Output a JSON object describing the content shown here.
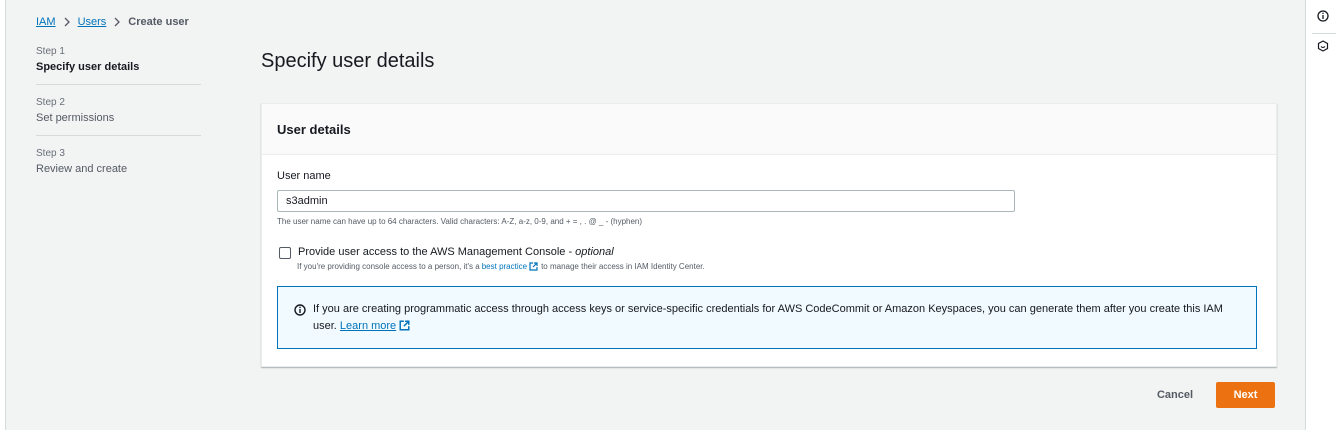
{
  "breadcrumb": {
    "items": [
      {
        "label": "IAM"
      },
      {
        "label": "Users"
      },
      {
        "label": "Create user"
      }
    ]
  },
  "steps": [
    {
      "number": "Step 1",
      "label": "Specify user details",
      "active": true
    },
    {
      "number": "Step 2",
      "label": "Set permissions",
      "active": false
    },
    {
      "number": "Step 3",
      "label": "Review and create",
      "active": false
    }
  ],
  "page": {
    "title": "Specify user details"
  },
  "card": {
    "title": "User details",
    "username": {
      "label": "User name",
      "value": "s3admin",
      "constraint": "The user name can have up to 64 characters. Valid characters: A-Z, a-z, 0-9, and + = , . @ _ - (hyphen)"
    },
    "console_access": {
      "label": "Provide user access to the AWS Management Console - ",
      "optional": "optional",
      "checked": false,
      "desc_before": "If you're providing console access to a person, it's a",
      "link": "best practice",
      "desc_after": "to manage their access in IAM Identity Center."
    },
    "info_alert": {
      "text": "If you are creating programmatic access through access keys or service-specific credentials for AWS CodeCommit or Amazon Keyspaces, you can generate them after you create this IAM user.",
      "link": "Learn more"
    }
  },
  "actions": {
    "cancel": "Cancel",
    "next": "Next"
  },
  "right_rail": {
    "icons": [
      "info-icon",
      "feedback-icon"
    ]
  },
  "colors": {
    "link": "#0073bb",
    "primary_button": "#ec7211",
    "alert_border": "#0073bb",
    "alert_background": "#f1faff",
    "page_background": "#f2f3f3"
  }
}
